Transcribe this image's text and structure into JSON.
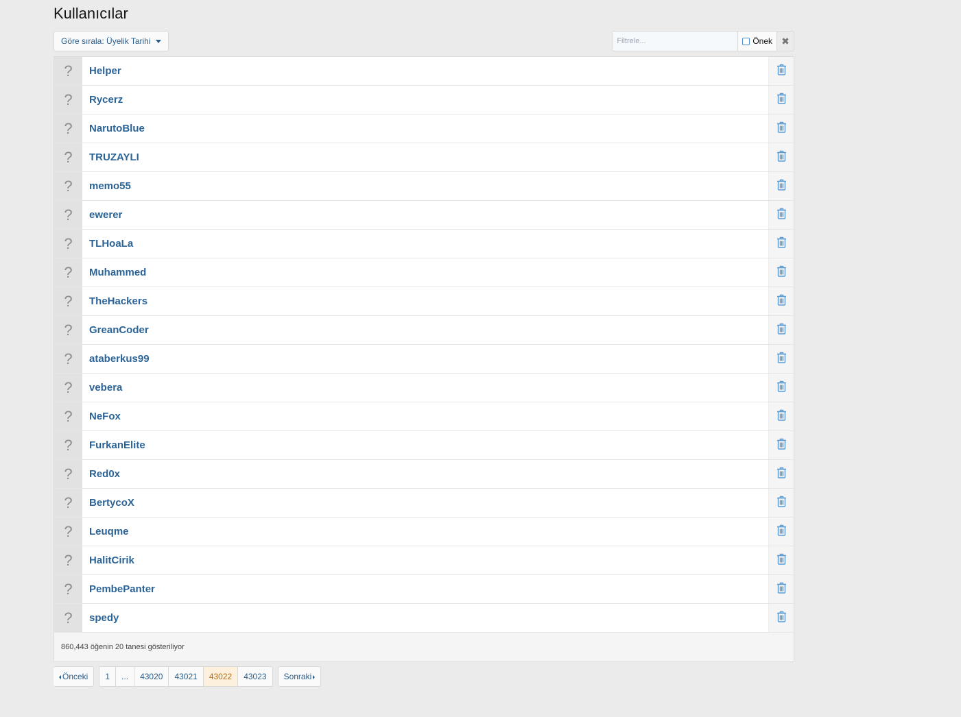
{
  "page": {
    "title": "Kullanıcılar"
  },
  "toolbar": {
    "sort_label": "Göre sırala: Üyelik Tarihi",
    "filter_placeholder": "Filtrele...",
    "prefix_label": "Önek",
    "prefix_checked": false,
    "clear_icon": "close-icon"
  },
  "users": [
    "Helper",
    "Rycerz",
    "NarutoBlue",
    "TRUZAYLI",
    "memo55",
    "ewerer",
    "TLHoaLa",
    "Muhammed",
    "TheHackers",
    "GreanCoder",
    "ataberkus99",
    "vebera",
    "NeFox",
    "FurkanElite",
    "Red0x",
    "BertycoX",
    "Leuqme",
    "HalitCirik",
    "PembePanter",
    "spedy"
  ],
  "row_icons": {
    "avatar": "question-mark-icon",
    "delete": "trash-icon"
  },
  "footer": {
    "summary": "860,443 öğenin 20 tanesi gösteriliyor"
  },
  "pagination": {
    "prev_label": "Önceki",
    "next_label": "Sonraki",
    "pages": [
      "1",
      "...",
      "43020",
      "43021",
      "43022",
      "43023"
    ],
    "current": "43022"
  },
  "colors": {
    "link": "#2b6396",
    "trash": "#5b9bd5",
    "current_page_bg": "#fdf1dd"
  }
}
